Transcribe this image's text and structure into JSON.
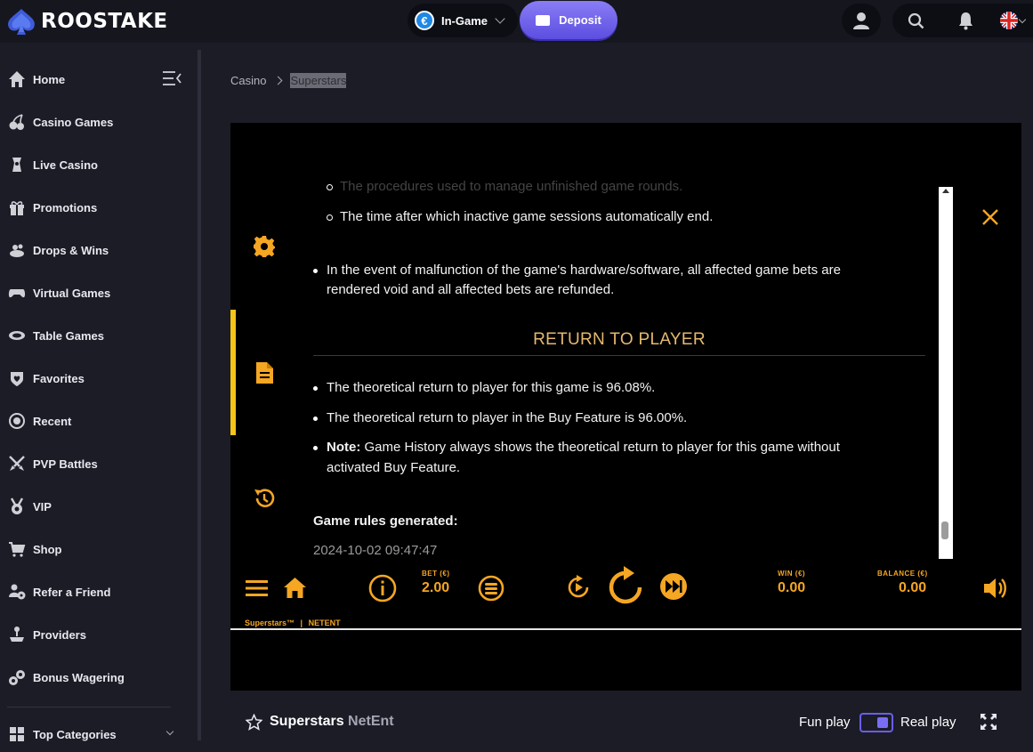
{
  "brand": {
    "name": "ROOSTAKE"
  },
  "header": {
    "wallet_label": "In-Game",
    "currency_symbol": "€",
    "deposit_label": "Deposit"
  },
  "sidebar": {
    "items": [
      {
        "label": "Home",
        "icon": "home-icon"
      },
      {
        "label": "Casino Games",
        "icon": "cherries-icon"
      },
      {
        "label": "Live Casino",
        "icon": "live-dealer-icon"
      },
      {
        "label": "Promotions",
        "icon": "gift-icon"
      },
      {
        "label": "Drops & Wins",
        "icon": "drops-icon"
      },
      {
        "label": "Virtual Games",
        "icon": "gamepad-icon"
      },
      {
        "label": "Table Games",
        "icon": "table-icon"
      },
      {
        "label": "Favorites",
        "icon": "heart-icon"
      },
      {
        "label": "Recent",
        "icon": "recent-icon"
      },
      {
        "label": "PVP Battles",
        "icon": "swords-icon"
      },
      {
        "label": "VIP",
        "icon": "medal-icon"
      },
      {
        "label": "Shop",
        "icon": "cart-icon"
      },
      {
        "label": "Refer a Friend",
        "icon": "refer-icon"
      },
      {
        "label": "Providers",
        "icon": "joystick-icon"
      },
      {
        "label": "Bonus Wagering",
        "icon": "wagering-icon"
      },
      {
        "label": "Top Categories",
        "icon": "category-icon"
      }
    ]
  },
  "breadcrumb": {
    "root": "Casino",
    "current": "Superstars"
  },
  "rules": {
    "faded_line": "The procedures used to manage unfinished game rounds.",
    "sub_bullet": "The time after which inactive game sessions automatically end.",
    "malfunction_line1": "In the event of malfunction of the game's hardware/software, all affected game bets are",
    "malfunction_line2": "rendered void and all affected bets are refunded.",
    "rtp_title": "RETURN TO PLAYER",
    "rtp_1": "The theoretical return to player for this game is 96.08%.",
    "rtp_2": "The theoretical return to player in the Buy Feature is 96.00%.",
    "note_label": "Note:",
    "note_line1": "Game History always shows the theoretical return to player for this game without",
    "note_line2": "activated Buy Feature.",
    "generated_label": "Game rules generated:",
    "generated_time": "2024-10-02 09:47:47"
  },
  "game_bar": {
    "bet_label": "BET (€)",
    "bet_value": "2.00",
    "win_label": "WIN (€)",
    "win_value": "0.00",
    "balance_label": "BALANCE (€)",
    "balance_value": "0.00",
    "credit_game": "Superstars™",
    "credit_provider": "NETENT"
  },
  "footer": {
    "game_title": "Superstars",
    "provider": "NetEnt",
    "fun_play": "Fun play",
    "real_play": "Real play"
  },
  "colors": {
    "accent_gold": "#f5a623",
    "rtp_title": "#e6b870",
    "deposit": "#6a5ee8",
    "sidebar_bg": "#1c1c27"
  }
}
